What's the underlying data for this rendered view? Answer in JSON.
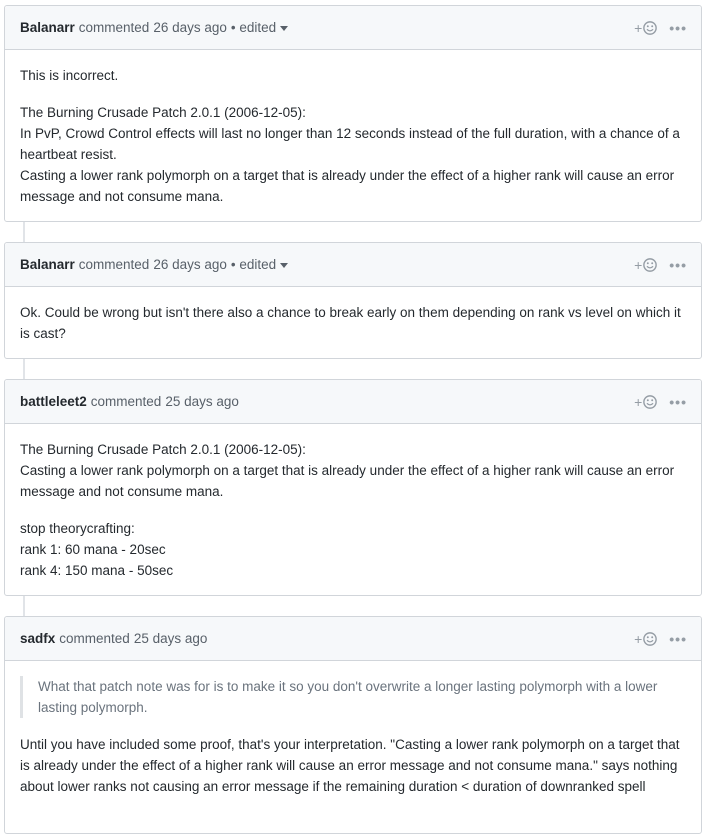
{
  "comments": [
    {
      "author": "Balanarr",
      "verb": "commented",
      "time": "26 days ago",
      "edited": "• edited",
      "body": {
        "p1": "This is incorrect.",
        "p2_l1": "The Burning Crusade Patch 2.0.1 (2006-12-05):",
        "p2_l2": "In PvP, Crowd Control effects will last no longer than 12 seconds instead of the full duration, with a chance of a heartbeat resist.",
        "p2_l3": "Casting a lower rank polymorph on a target that is already under the effect of a higher rank will cause an error message and not consume mana."
      }
    },
    {
      "author": "Balanarr",
      "verb": "commented",
      "time": "26 days ago",
      "edited": "• edited",
      "body": {
        "p1": "Ok. Could be wrong but isn't there also a chance to break early on them depending on rank vs level on which it is cast?"
      }
    },
    {
      "author": "battleleet2",
      "verb": "commented",
      "time": "25 days ago",
      "body": {
        "p1_l1": "The Burning Crusade Patch 2.0.1 (2006-12-05):",
        "p1_l2": "Casting a lower rank polymorph on a target that is already under the effect of a higher rank will cause an error message and not consume mana.",
        "p2_l1": "stop theorycrafting:",
        "p2_l2": "rank 1: 60 mana - 20sec",
        "p2_l3": "rank 4: 150 mana - 50sec"
      }
    },
    {
      "author": "sadfx",
      "verb": "commented",
      "time": "25 days ago",
      "body": {
        "quote": "What that patch note was for is to make it so you don't overwrite a longer lasting polymorph with a lower lasting polymorph.",
        "p1": "Until you have included some proof, that's your interpretation. \"Casting a lower rank polymorph on a target that is already under the effect of a higher rank will cause an error message and not consume mana.\" says nothing about lower ranks not causing an error message if the remaining duration < duration of downranked spell"
      }
    }
  ],
  "icons": {
    "add_reaction": "smiley-icon",
    "more_actions": "kebab-icon"
  },
  "reaction_plus": "+",
  "more_glyph": "•••"
}
